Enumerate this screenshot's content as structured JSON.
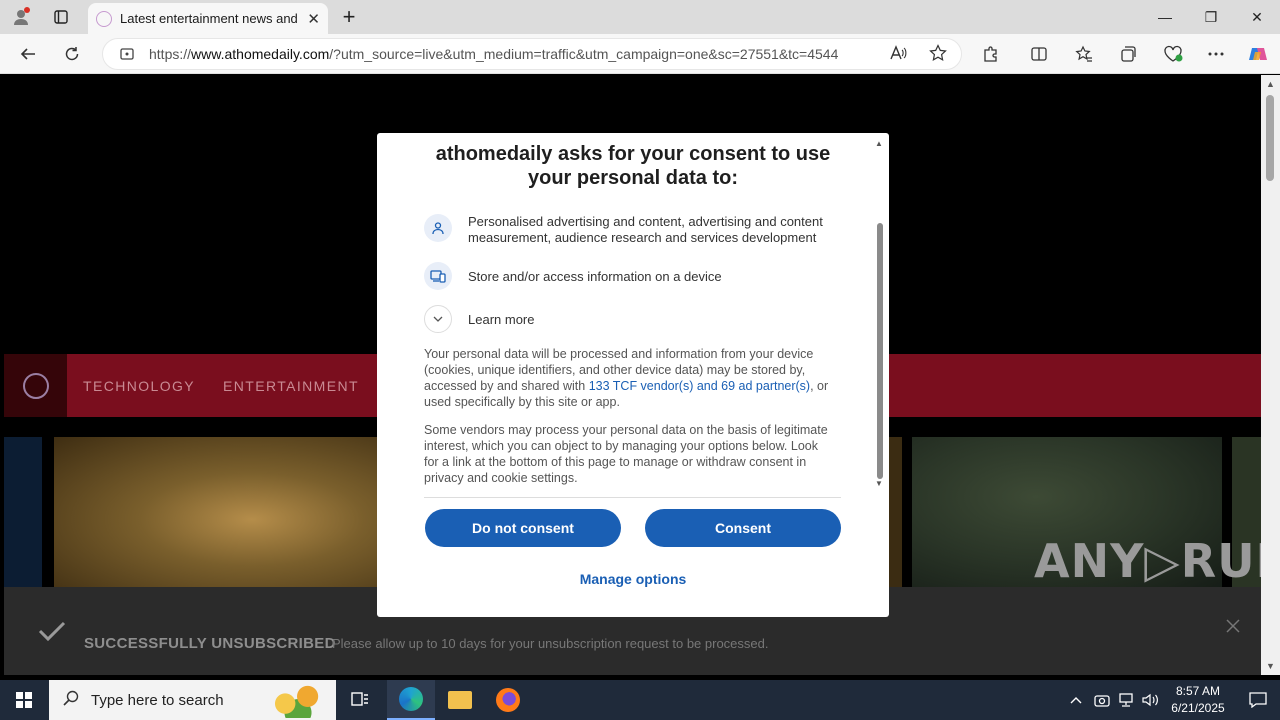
{
  "browser": {
    "tab_title": "Latest entertainment news and re",
    "url_prefix": "https://",
    "url_domain": "www.athomedaily.com",
    "url_rest": "/?utm_source=live&utm_medium=traffic&utm_campaign=one&sc=27551&tc=4544",
    "new_tab_glyph": "+",
    "close_glyph": "✕",
    "minimize_glyph": "—",
    "restore_glyph": "❐"
  },
  "page": {
    "nav_items": [
      "TECHNOLOGY",
      "ENTERTAINMENT"
    ],
    "toast": {
      "title": "SUCCESSFULLY UNSUBSCRIBED",
      "message": "Please allow up to 10 days for your unsubscription request to be processed."
    },
    "watermark": "ANY▷RUN"
  },
  "consent": {
    "title": "athomedaily asks for your consent to use your personal data to:",
    "purposes": [
      {
        "icon": "person-icon",
        "text": "Personalised advertising and content, advertising and content measurement, audience research and services development"
      },
      {
        "icon": "device-icon",
        "text": "Store and/or access information on a device"
      }
    ],
    "learn_more": "Learn more",
    "para1_before": "Your personal data will be processed and information from your device (cookies, unique identifiers, and other device data) may be stored by, accessed by and shared with ",
    "para1_link": "133 TCF vendor(s) and 69 ad partner(s)",
    "para1_after": ", or used specifically by this site or app.",
    "para2": "Some vendors may process your personal data on the basis of legitimate interest, which you can object to by managing your options below. Look for a link at the bottom of this page to manage or withdraw consent in privacy and cookie settings.",
    "do_not_consent": "Do not consent",
    "consent": "Consent",
    "manage_options": "Manage options"
  },
  "taskbar": {
    "search_placeholder": "Type here to search",
    "time": "8:57 AM",
    "date": "6/21/2025"
  },
  "colors": {
    "accent": "#1a5fb4",
    "nav_bg": "#7a0e1e",
    "taskbar_bg": "#1f2a3a"
  }
}
